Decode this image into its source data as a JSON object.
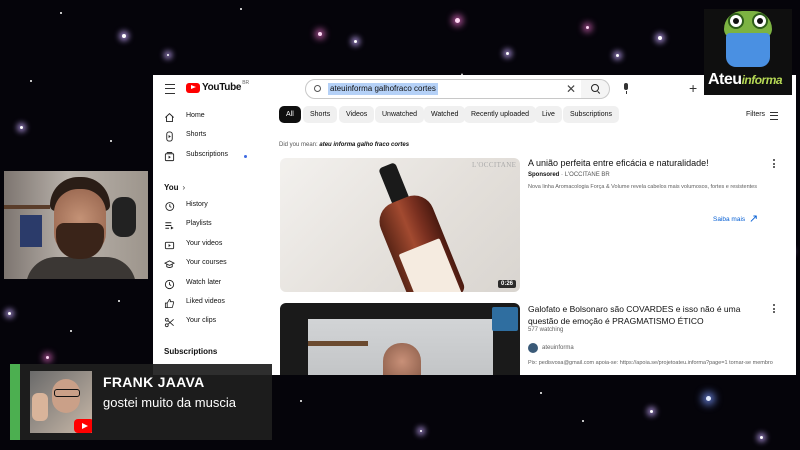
{
  "youtube": {
    "logo_text": "YouTube",
    "logo_sup": "BR",
    "search": {
      "query": "ateuinforma galhofraco cortes"
    },
    "sidebar": {
      "items": [
        {
          "label": "Home",
          "icon": "home-icon"
        },
        {
          "label": "Shorts",
          "icon": "shorts-icon"
        },
        {
          "label": "Subscriptions",
          "icon": "subscriptions-icon"
        }
      ],
      "you_header": "You",
      "you_items": [
        {
          "label": "History",
          "icon": "history-icon"
        },
        {
          "label": "Playlists",
          "icon": "playlists-icon"
        },
        {
          "label": "Your videos",
          "icon": "your-videos-icon"
        },
        {
          "label": "Your courses",
          "icon": "courses-icon"
        },
        {
          "label": "Watch later",
          "icon": "clock-icon"
        },
        {
          "label": "Liked videos",
          "icon": "thumbs-up-icon"
        },
        {
          "label": "Your clips",
          "icon": "scissors-icon"
        }
      ],
      "subscriptions_header": "Subscriptions"
    },
    "chips": [
      "All",
      "Shorts",
      "Videos",
      "Unwatched",
      "Watched",
      "Recently uploaded",
      "Live",
      "Subscriptions"
    ],
    "filters_label": "Filters",
    "did_you_mean": {
      "prefix": "Did you mean:",
      "suggestion": "ateu informa galho fraco cortes"
    },
    "ad": {
      "brand_mark": "L'OCCITANE",
      "title": "A união perfeita entre eficácia e naturalidade!",
      "sponsored": "Sponsored",
      "advertiser": "L'OCCITANE BR",
      "description": "Nova linha Aromacologia Força & Volume revela cabelos mais volumosos, fortes e resistentes",
      "cta": "Saiba mais",
      "duration": "0:26"
    },
    "result": {
      "title": "Galofato e Bolsonaro são COVARDES e isso não é uma questão de emoção é PRAGMATISMO ÉTICO",
      "views": "577 watching",
      "channel": "ateuinforma",
      "description": "Pix: pedisvosa@gmail.com apoia-se: https://apoia.se/projetoateu.informa?page=1 tornar-se membro"
    }
  },
  "logo": {
    "text_main": "Ateu",
    "text_secondary": "informa"
  },
  "chat": {
    "name": "FRANK JAAVA",
    "message": "gostei muito da muscia"
  },
  "colors": {
    "chat_accent": "#4caf50",
    "youtube_red": "#ff0000",
    "link_blue": "#065fd4"
  }
}
